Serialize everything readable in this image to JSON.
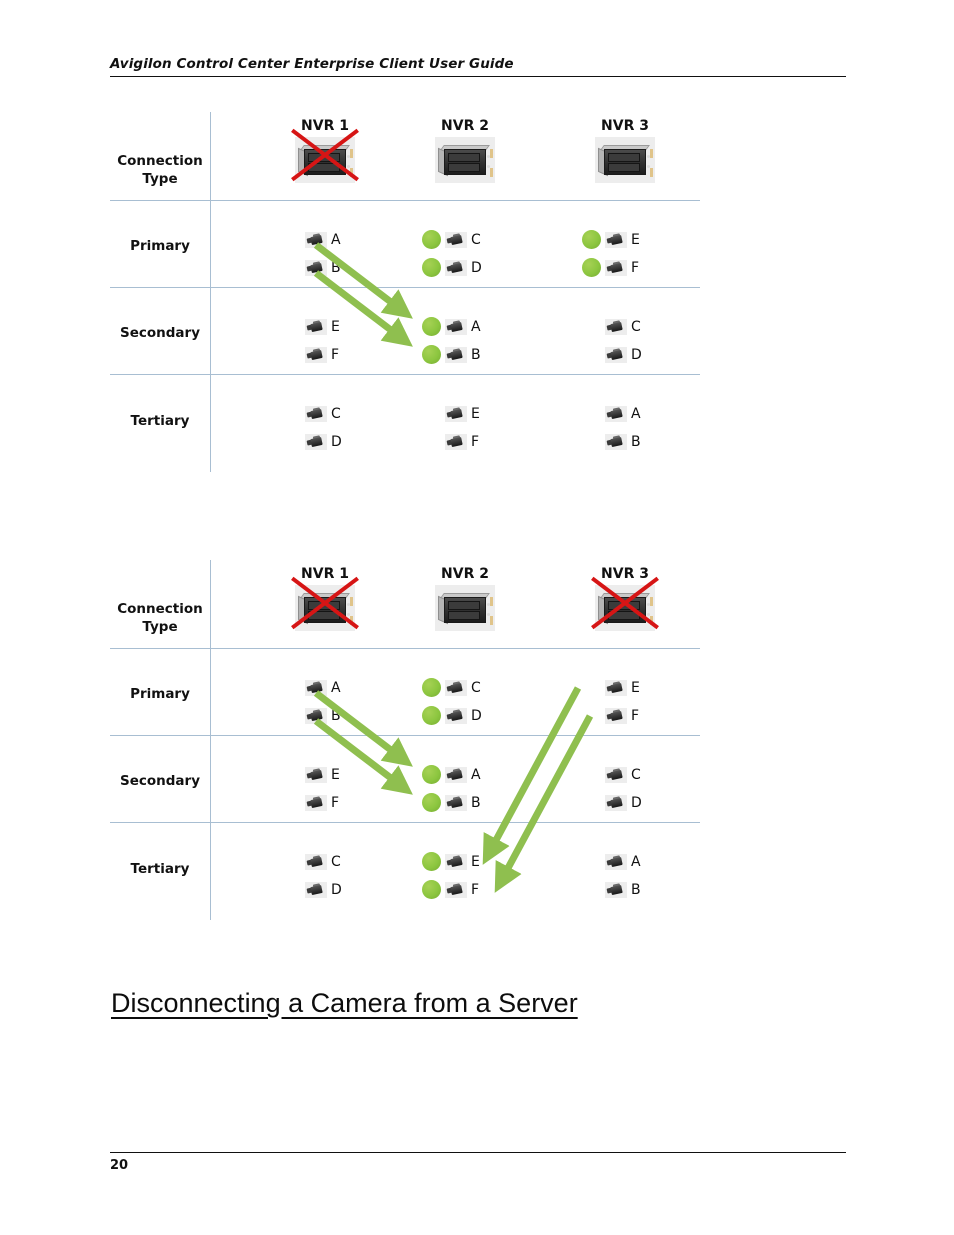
{
  "header": {
    "title": "Avigilon Control Center Enterprise Client User Guide"
  },
  "footer": {
    "page_number": "20"
  },
  "section": {
    "heading": "Disconnecting a Camera from a Server"
  },
  "colors": {
    "grid_line": "#a8bed2",
    "red_x": "#d61515",
    "green_dot": "#8cc63f",
    "arrow": "#8fbf4f",
    "rule": "#111111"
  },
  "row_labels": {
    "connection_type": "Connection\nType",
    "connection_type_line1": "Connection",
    "connection_type_line2": "Type",
    "primary": "Primary",
    "secondary": "Secondary",
    "tertiary": "Tertiary"
  },
  "diagrams": [
    {
      "id": "diagram-1",
      "servers": [
        {
          "name": "NVR 1",
          "offline": true,
          "icon": "server-icon"
        },
        {
          "name": "NVR 2",
          "offline": false,
          "icon": "server-icon"
        },
        {
          "name": "NVR 3",
          "offline": false,
          "icon": "server-icon"
        }
      ],
      "rows": [
        {
          "label": "Primary",
          "cells": [
            {
              "cameras": [
                {
                  "label": "A",
                  "active": false
                },
                {
                  "label": "B",
                  "active": false
                }
              ]
            },
            {
              "cameras": [
                {
                  "label": "C",
                  "active": true
                },
                {
                  "label": "D",
                  "active": true
                }
              ]
            },
            {
              "cameras": [
                {
                  "label": "E",
                  "active": true
                },
                {
                  "label": "F",
                  "active": true
                }
              ]
            }
          ]
        },
        {
          "label": "Secondary",
          "cells": [
            {
              "cameras": [
                {
                  "label": "E",
                  "active": false
                },
                {
                  "label": "F",
                  "active": false
                }
              ]
            },
            {
              "cameras": [
                {
                  "label": "A",
                  "active": true
                },
                {
                  "label": "B",
                  "active": true
                }
              ]
            },
            {
              "cameras": [
                {
                  "label": "C",
                  "active": false
                },
                {
                  "label": "D",
                  "active": false
                }
              ]
            }
          ]
        },
        {
          "label": "Tertiary",
          "cells": [
            {
              "cameras": [
                {
                  "label": "C",
                  "active": false
                },
                {
                  "label": "D",
                  "active": false
                }
              ]
            },
            {
              "cameras": [
                {
                  "label": "E",
                  "active": false
                },
                {
                  "label": "F",
                  "active": false
                }
              ]
            },
            {
              "cameras": [
                {
                  "label": "A",
                  "active": false
                },
                {
                  "label": "B",
                  "active": false
                }
              ]
            }
          ]
        }
      ],
      "arrows": [
        {
          "from": "NVR1 Primary A",
          "to": "NVR2 Secondary A"
        },
        {
          "from": "NVR1 Primary B",
          "to": "NVR2 Secondary B"
        }
      ]
    },
    {
      "id": "diagram-2",
      "servers": [
        {
          "name": "NVR 1",
          "offline": true,
          "icon": "server-icon"
        },
        {
          "name": "NVR 2",
          "offline": false,
          "icon": "server-icon"
        },
        {
          "name": "NVR 3",
          "offline": true,
          "icon": "server-icon"
        }
      ],
      "rows": [
        {
          "label": "Primary",
          "cells": [
            {
              "cameras": [
                {
                  "label": "A",
                  "active": false
                },
                {
                  "label": "B",
                  "active": false
                }
              ]
            },
            {
              "cameras": [
                {
                  "label": "C",
                  "active": true
                },
                {
                  "label": "D",
                  "active": true
                }
              ]
            },
            {
              "cameras": [
                {
                  "label": "E",
                  "active": false
                },
                {
                  "label": "F",
                  "active": false
                }
              ]
            }
          ]
        },
        {
          "label": "Secondary",
          "cells": [
            {
              "cameras": [
                {
                  "label": "E",
                  "active": false
                },
                {
                  "label": "F",
                  "active": false
                }
              ]
            },
            {
              "cameras": [
                {
                  "label": "A",
                  "active": true
                },
                {
                  "label": "B",
                  "active": true
                }
              ]
            },
            {
              "cameras": [
                {
                  "label": "C",
                  "active": false
                },
                {
                  "label": "D",
                  "active": false
                }
              ]
            }
          ]
        },
        {
          "label": "Tertiary",
          "cells": [
            {
              "cameras": [
                {
                  "label": "C",
                  "active": false
                },
                {
                  "label": "D",
                  "active": false
                }
              ]
            },
            {
              "cameras": [
                {
                  "label": "E",
                  "active": true
                },
                {
                  "label": "F",
                  "active": true
                }
              ]
            },
            {
              "cameras": [
                {
                  "label": "A",
                  "active": false
                },
                {
                  "label": "B",
                  "active": false
                }
              ]
            }
          ]
        }
      ],
      "arrows": [
        {
          "from": "NVR1 Primary A",
          "to": "NVR2 Secondary A"
        },
        {
          "from": "NVR1 Primary B",
          "to": "NVR2 Secondary B"
        },
        {
          "from": "NVR3 Primary E",
          "to": "NVR2 Tertiary E"
        },
        {
          "from": "NVR3 Primary F",
          "to": "NVR2 Tertiary F"
        }
      ]
    }
  ]
}
